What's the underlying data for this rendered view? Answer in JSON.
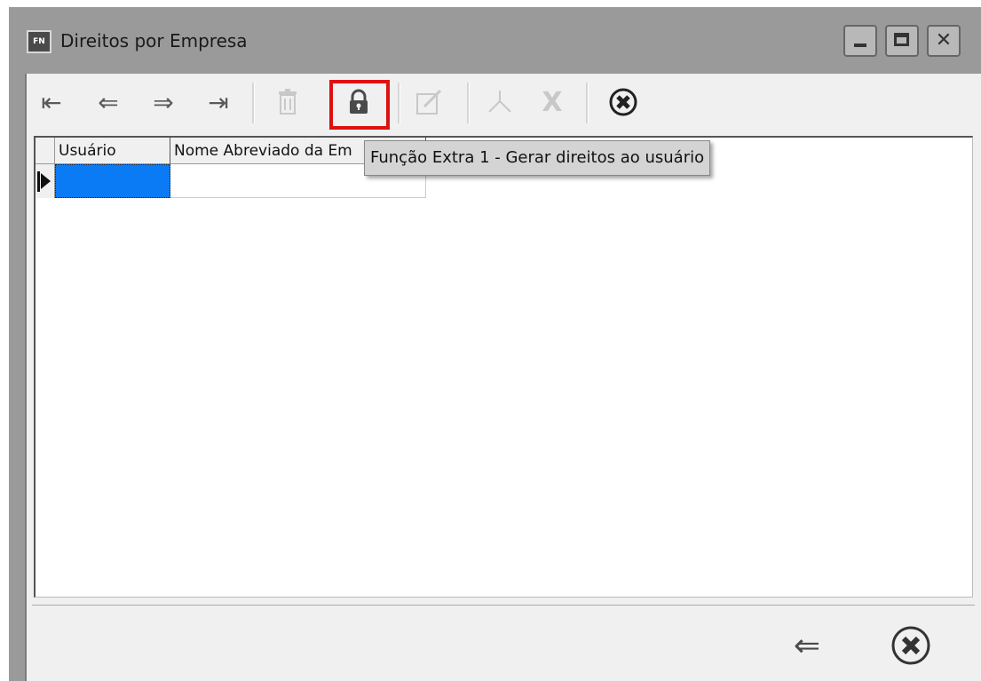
{
  "window": {
    "title": "Direitos por Empresa",
    "app_icon_text": "FN"
  },
  "toolbar": {
    "buttons": [
      {
        "name": "first-record",
        "icon": "⇤",
        "enabled": true
      },
      {
        "name": "previous-record",
        "icon": "⇐",
        "enabled": true
      },
      {
        "name": "next-record",
        "icon": "⇒",
        "enabled": true
      },
      {
        "name": "last-record",
        "icon": "⇥",
        "enabled": true
      },
      {
        "name": "delete",
        "icon": "trash-icon",
        "enabled": false
      },
      {
        "name": "extra-function-1",
        "icon": "lock-icon",
        "enabled": true,
        "highlighted": true
      },
      {
        "name": "edit",
        "icon": "edit-icon",
        "enabled": false
      },
      {
        "name": "confirm",
        "icon": "check-icon",
        "enabled": false
      },
      {
        "name": "cancel-edit",
        "icon": "x-icon",
        "enabled": false
      },
      {
        "name": "close",
        "icon": "circle-x-icon",
        "enabled": true
      }
    ]
  },
  "grid": {
    "columns": [
      "Usuário",
      "Nome Abreviado da Em"
    ],
    "rows": [
      [
        "",
        ""
      ]
    ]
  },
  "tooltip": {
    "text": "Função Extra 1 - Gerar direitos ao usuário"
  },
  "bottom": {
    "back_icon": "⇐",
    "cancel_icon": "circle-x-icon"
  },
  "colors": {
    "titlebar": "#9a9a9a",
    "selection": "#0a7bf5",
    "highlight": "#e01010"
  }
}
